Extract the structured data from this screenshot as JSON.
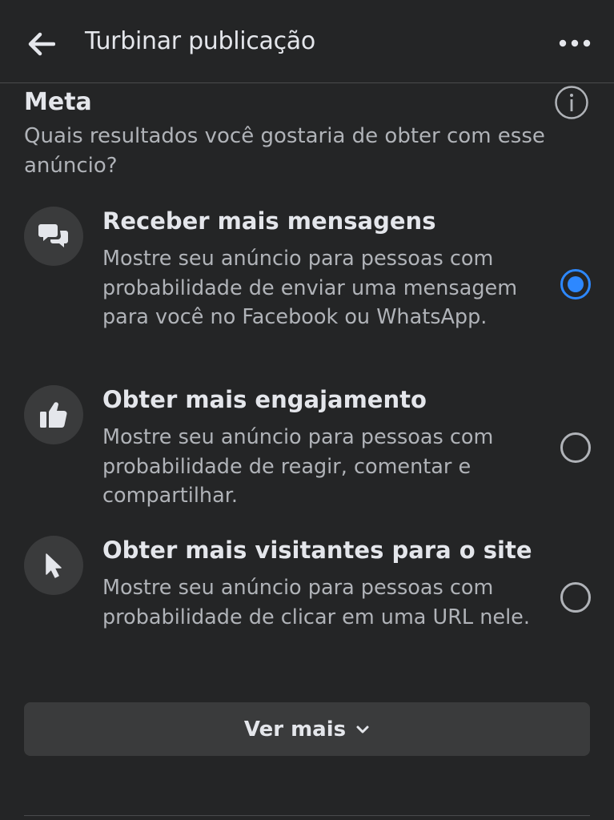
{
  "header": {
    "title": "Turbinar publicação",
    "back_icon": "arrow-left-icon",
    "more_icon": "more-horizontal-icon"
  },
  "goal_section": {
    "title": "Meta",
    "question": "Quais resultados você gostaria de obter com esse anúncio?",
    "info_icon": "info-icon"
  },
  "options": [
    {
      "icon": "chat-bubbles-icon",
      "title": "Receber mais mensagens",
      "description": "Mostre seu anúncio para pessoas com probabilidade de enviar uma mensagem para você no Facebook ou WhatsApp.",
      "selected": true
    },
    {
      "icon": "thumbs-up-icon",
      "title": "Obter mais engajamento",
      "description": "Mostre seu anúncio para pessoas com probabilidade de reagir, comentar e compartilhar.",
      "selected": false
    },
    {
      "icon": "cursor-pointer-icon",
      "title": "Obter mais visitantes para o site",
      "description": "Mostre seu anúncio para pessoas com probabilidade de clicar em uma URL nele.",
      "selected": false
    }
  ],
  "see_more": {
    "label": "Ver mais",
    "icon": "chevron-down-icon"
  },
  "colors": {
    "background": "#242526",
    "surface": "#3a3b3c",
    "text_primary": "#e4e6eb",
    "text_secondary": "#b0b3b8",
    "accent": "#2d88ff"
  }
}
